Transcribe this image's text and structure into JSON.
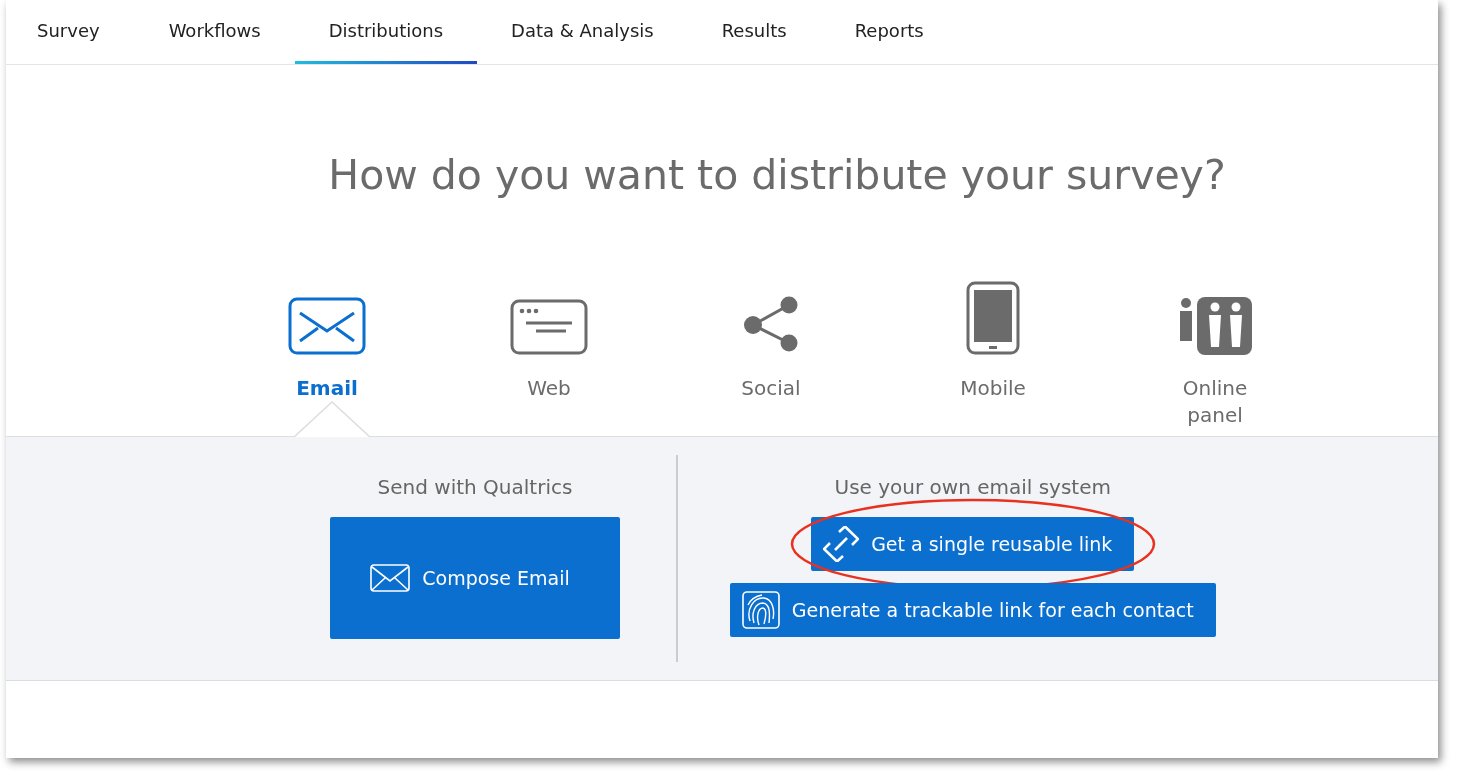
{
  "tabs": [
    {
      "label": "Survey",
      "selected": false
    },
    {
      "label": "Workflows",
      "selected": false
    },
    {
      "label": "Distributions",
      "selected": true
    },
    {
      "label": "Data & Analysis",
      "selected": false
    },
    {
      "label": "Results",
      "selected": false
    },
    {
      "label": "Reports",
      "selected": false
    }
  ],
  "heading": "How do you want to distribute your survey?",
  "channels": [
    {
      "kind": "email",
      "label": "Email",
      "selected": true
    },
    {
      "kind": "web",
      "label": "Web",
      "selected": false
    },
    {
      "kind": "social",
      "label": "Social",
      "selected": false
    },
    {
      "kind": "mobile",
      "label": "Mobile",
      "selected": false
    },
    {
      "kind": "panel",
      "label": "Online panel",
      "selected": false
    }
  ],
  "panel": {
    "left": {
      "title": "Send with Qualtrics",
      "button": "Compose Email"
    },
    "right": {
      "title": "Use your own email system",
      "buttons": [
        {
          "kind": "link",
          "label": "Get a single reusable link",
          "highlighted": true
        },
        {
          "kind": "fingerprint",
          "label": "Generate a trackable link for each contact",
          "highlighted": false
        }
      ]
    }
  }
}
